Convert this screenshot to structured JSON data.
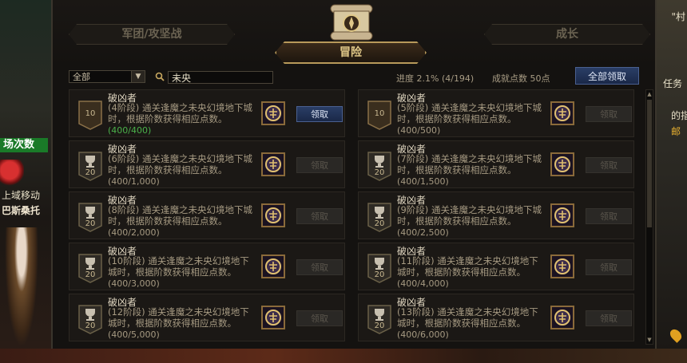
{
  "background": {
    "left_badge": "场次数",
    "left_text1": "上域移动",
    "left_text2": "巴斯桑托",
    "right_top": "\"村",
    "right_task": "任务",
    "right_text2": "的指",
    "right_text3": "邮"
  },
  "tabs": {
    "left": "军团/攻坚战",
    "right": "成长",
    "active": "冒险"
  },
  "filter": {
    "category_selected": "全部",
    "search_value": "未央"
  },
  "summary": {
    "progress_label": "进度",
    "progress_value": "2.1% (4/194)",
    "points_label": "成就点数",
    "points_value": "50点",
    "claim_all_label": "全部领取"
  },
  "cards": [
    {
      "badge": "10",
      "badge_type": "flag",
      "title": "破凶者",
      "desc": "(4阶段) 通关逢魔之未央幻境地下城时，根据阶数获得相应点数。",
      "count": "(400/400)",
      "done": true,
      "button": "领取",
      "enabled": true
    },
    {
      "badge": "10",
      "badge_type": "flag",
      "title": "破凶者",
      "desc": "(5阶段) 通关逢魔之未央幻境地下城时，根据阶数获得相应点数。",
      "count": "(400/500)",
      "done": false,
      "button": "领取",
      "enabled": false
    },
    {
      "badge": "20",
      "badge_type": "trophy",
      "title": "破凶者",
      "desc": "(6阶段) 通关逢魔之未央幻境地下城时，根据阶数获得相应点数。",
      "count": "(400/1,000)",
      "done": false,
      "button": "领取",
      "enabled": false
    },
    {
      "badge": "20",
      "badge_type": "trophy",
      "title": "破凶者",
      "desc": "(7阶段) 通关逢魔之未央幻境地下城时，根据阶数获得相应点数。",
      "count": "(400/1,500)",
      "done": false,
      "button": "领取",
      "enabled": false
    },
    {
      "badge": "20",
      "badge_type": "trophy",
      "title": "破凶者",
      "desc": "(8阶段) 通关逢魔之未央幻境地下城时，根据阶数获得相应点数。",
      "count": "(400/2,000)",
      "done": false,
      "button": "领取",
      "enabled": false
    },
    {
      "badge": "20",
      "badge_type": "trophy",
      "title": "破凶者",
      "desc": "(9阶段) 通关逢魔之未央幻境地下城时，根据阶数获得相应点数。",
      "count": "(400/2,500)",
      "done": false,
      "button": "领取",
      "enabled": false
    },
    {
      "badge": "20",
      "badge_type": "trophy",
      "title": "破凶者",
      "desc": "(10阶段) 通关逢魔之未央幻境地下城时，根据阶数获得相应点数。",
      "count": "(400/3,000)",
      "done": false,
      "button": "领取",
      "enabled": false
    },
    {
      "badge": "20",
      "badge_type": "trophy",
      "title": "破凶者",
      "desc": "(11阶段) 通关逢魔之未央幻境地下城时，根据阶数获得相应点数。",
      "count": "(400/4,000)",
      "done": false,
      "button": "领取",
      "enabled": false
    },
    {
      "badge": "20",
      "badge_type": "trophy",
      "title": "破凶者",
      "desc": "(12阶段) 通关逢魔之未央幻境地下城时，根据阶数获得相应点数。",
      "count": "(400/5,000)",
      "done": false,
      "button": "领取",
      "enabled": false
    },
    {
      "badge": "20",
      "badge_type": "trophy",
      "title": "破凶者",
      "desc": "(13阶段) 通关逢魔之未央幻境地下城时，根据阶数获得相应点数。",
      "count": "(400/6,000)",
      "done": false,
      "button": "领取",
      "enabled": false
    }
  ],
  "colors": {
    "panel_bg": "#141210",
    "button_blue": "#2a3e66",
    "complete_green": "#4ab04a",
    "gold_border": "#b89a5a"
  }
}
